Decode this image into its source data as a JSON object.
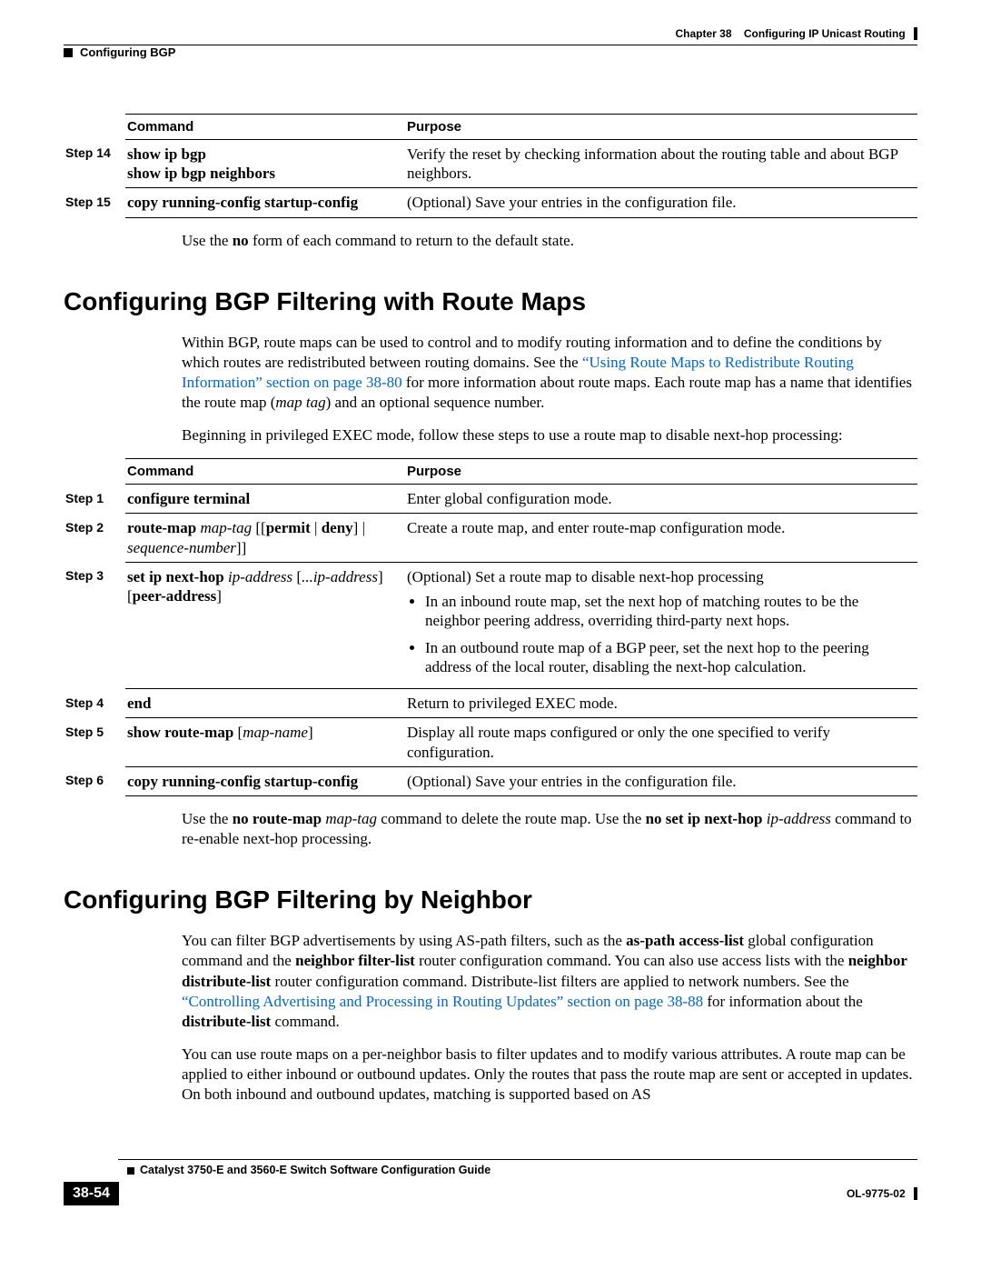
{
  "header": {
    "chapter": "Chapter 38",
    "title": "Configuring IP Unicast Routing",
    "section": "Configuring BGP"
  },
  "table1": {
    "h1": "Command",
    "h2": "Purpose",
    "rows": [
      {
        "step": "Step 14",
        "cmd1": "show ip bgp",
        "cmd2": "show ip bgp neighbors",
        "purpose": "Verify the reset by checking information about the routing table and about BGP neighbors."
      },
      {
        "step": "Step 15",
        "cmd1": "copy running-config startup-config",
        "purpose": "(Optional) Save your entries in the configuration file."
      }
    ]
  },
  "note1_a": "Use the ",
  "note1_b": "no",
  "note1_c": " form of each command to return to the default state.",
  "h2_1": "Configuring BGP Filtering with Route Maps",
  "para1_a": "Within BGP, route maps can be used to control and to modify routing information and to define the conditions by which routes are redistributed between routing domains. See the ",
  "para1_link": "“Using Route Maps to Redistribute Routing Information” section on page 38-80",
  "para1_b": " for more information about route maps. Each route map has a name that identifies the route map (",
  "para1_i": "map tag",
  "para1_c": ") and an optional sequence number.",
  "para2": "Beginning in privileged EXEC mode, follow these steps to use a route map to disable next-hop processing:",
  "table2": {
    "h1": "Command",
    "h2": "Purpose",
    "rows": {
      "s1": {
        "step": "Step 1",
        "cmd": "configure terminal",
        "purpose": "Enter global configuration mode."
      },
      "s2": {
        "step": "Step 2",
        "cmd_b1": "route-map",
        "cmd_i1": " map-tag",
        "cmd_t1": " [[",
        "cmd_b2": "permit",
        "cmd_t2": " | ",
        "cmd_b3": "deny",
        "cmd_t3": "] | ",
        "cmd_i2": "sequence-number",
        "cmd_t4": "]]",
        "purpose": "Create a route map, and enter route-map configuration mode."
      },
      "s3": {
        "step": "Step 3",
        "cmd_b1": "set ip next-hop",
        "cmd_i1": " ip-address",
        "cmd_t1": " [",
        "cmd_i2": "...ip-address",
        "cmd_t2": "] [",
        "cmd_b2": "peer-address",
        "cmd_t3": "]",
        "purpose": "(Optional) Set a route map to disable next-hop processing",
        "b1": "In an inbound route map, set the next hop of matching routes to be the neighbor peering address, overriding third-party next hops.",
        "b2": "In an outbound route map of a BGP peer, set the next hop to the peering address of the local router, disabling the next-hop calculation."
      },
      "s4": {
        "step": "Step 4",
        "cmd": "end",
        "purpose": "Return to privileged EXEC mode."
      },
      "s5": {
        "step": "Step 5",
        "cmd_b1": "show route-map",
        "cmd_t1": " [",
        "cmd_i1": "map-name",
        "cmd_t2": "]",
        "purpose": "Display all route maps configured or only the one specified to verify configuration."
      },
      "s6": {
        "step": "Step 6",
        "cmd": "copy running-config startup-config",
        "purpose": "(Optional) Save your entries in the configuration file."
      }
    }
  },
  "note2_a": "Use the ",
  "note2_b1": "no route-map",
  "note2_i1": " map-tag",
  "note2_c": " command to delete the route map. Use the ",
  "note2_b2": "no set ip next-hop",
  "note2_i2": " ip-address",
  "note2_d": " command to re-enable next-hop processing.",
  "h2_2": "Configuring BGP Filtering by Neighbor",
  "para3_a": "You can filter BGP advertisements by using AS-path filters, such as the ",
  "para3_b1": "as-path access-list",
  "para3_b": " global configuration command and the ",
  "para3_b2": "neighbor filter-list",
  "para3_c": " router configuration command. You can also use access lists with the ",
  "para3_b3": "neighbor distribute-list",
  "para3_d": " router configuration command. Distribute-list filters are applied to network numbers. See the ",
  "para3_link": "“Controlling Advertising and Processing in Routing Updates” section on page 38-88",
  "para3_e": " for information about the ",
  "para3_b4": "distribute-list",
  "para3_f": " command.",
  "para4": "You can use route maps on a per-neighbor basis to filter updates and to modify various attributes. A route map can be applied to either inbound or outbound updates. Only the routes that pass the route map are sent or accepted in updates. On both inbound and outbound updates, matching is supported based on AS",
  "footer": {
    "page": "38-54",
    "guide": "Catalyst 3750-E and 3560-E Switch Software Configuration Guide",
    "doc": "OL-9775-02"
  }
}
